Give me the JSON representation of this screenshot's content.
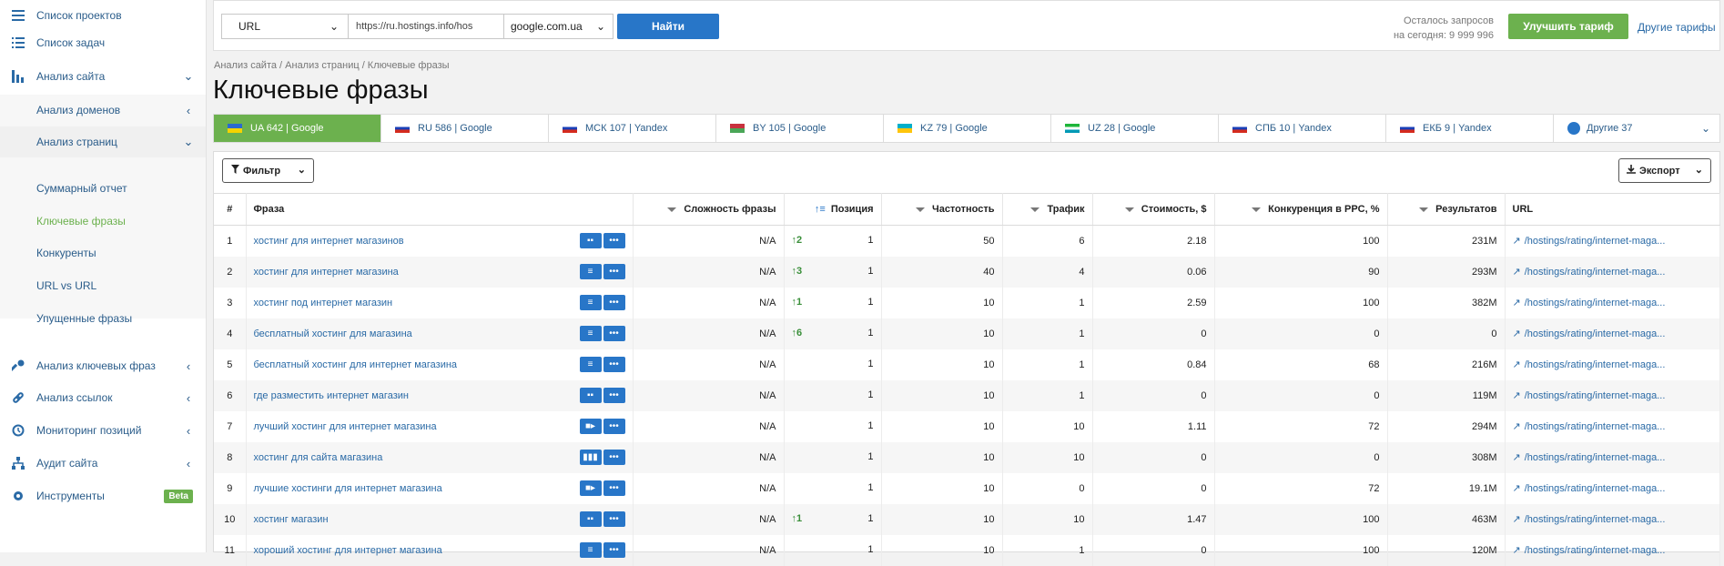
{
  "sidebar": {
    "items": [
      {
        "label": "Список проектов",
        "icon": "menu-icon"
      },
      {
        "label": "Список задач",
        "icon": "list-icon"
      },
      {
        "label": "Анализ сайта",
        "icon": "analytics-icon"
      },
      {
        "label": "Анализ доменов"
      },
      {
        "label": "Анализ страниц"
      },
      {
        "label": "Суммарный отчет"
      },
      {
        "label": "Ключевые фразы"
      },
      {
        "label": "Конкуренты"
      },
      {
        "label": "URL vs URL"
      },
      {
        "label": "Упущенные фразы"
      },
      {
        "label": "Анализ ключевых фраз",
        "icon": "key-icon"
      },
      {
        "label": "Анализ ссылок",
        "icon": "link-icon"
      },
      {
        "label": "Мониторинг позиций",
        "icon": "history-icon"
      },
      {
        "label": "Аудит сайта",
        "icon": "sitemap-icon"
      },
      {
        "label": "Инструменты",
        "icon": "gear-icon",
        "badge": "Beta"
      }
    ]
  },
  "search": {
    "type_value": "URL",
    "url_value": "https://ru.hostings.info/hos",
    "db_value": "google.com.ua",
    "find_label": "Найти"
  },
  "quota": {
    "line1": "Осталось запросов",
    "line2": "на сегодня: 9 999 996"
  },
  "upgrade_label": "Улучшить тариф",
  "other_tariffs_label": "Другие тарифы",
  "breadcrumb": "Анализ сайта / Анализ страниц / Ключевые фразы",
  "page_title": "Ключевые фразы",
  "tabs": [
    {
      "label": "UA 642 | Google",
      "flag": [
        "#2a6ad0",
        "#f5d300"
      ]
    },
    {
      "label": "RU 586 | Google",
      "flag": [
        "#ffffff",
        "#1a3fb8",
        "#d52b1e"
      ]
    },
    {
      "label": "МСК 107 | Yandex",
      "flag": [
        "#ffffff",
        "#1a3fb8",
        "#d52b1e"
      ]
    },
    {
      "label": "BY 105 | Google",
      "flag": [
        "#c8313e",
        "#4aa657"
      ]
    },
    {
      "label": "KZ 79 | Google",
      "flag": [
        "#00afca",
        "#fec50c"
      ]
    },
    {
      "label": "UZ 28 | Google",
      "flag": [
        "#1eb53a",
        "#ffffff",
        "#0099b5"
      ]
    },
    {
      "label": "СПБ 10 | Yandex",
      "flag": [
        "#ffffff",
        "#1a3fb8",
        "#d52b1e"
      ]
    },
    {
      "label": "ЕКБ 9 | Yandex",
      "flag": [
        "#ffffff",
        "#1a3fb8",
        "#d52b1e"
      ]
    },
    {
      "label": "Другие 37",
      "icon": "globe-icon"
    }
  ],
  "filter_label": "Фильтр",
  "export_label": "Экспорт",
  "table": {
    "headers": [
      "#",
      "Фраза",
      "Сложность фразы",
      "Позиция",
      "Частотность",
      "Трафик",
      "Стоимость, $",
      "Конкуренция в PPC, %",
      "Результатов",
      "URL"
    ],
    "rows": [
      {
        "n": "1",
        "phrase": "хостинг для интернет магазинов",
        "icon1": "chat-icon",
        "diff": "N/A",
        "change": "2",
        "pos": "1",
        "freq": "50",
        "traffic": "6",
        "cost": "2.18",
        "ppc": "100",
        "results": "231M",
        "url": "/hostings/rating/internet-maga..."
      },
      {
        "n": "2",
        "phrase": "хостинг для интернет магазина",
        "icon1": "text-icon",
        "diff": "N/A",
        "change": "3",
        "pos": "1",
        "freq": "40",
        "traffic": "4",
        "cost": "0.06",
        "ppc": "90",
        "results": "293M",
        "url": "/hostings/rating/internet-maga..."
      },
      {
        "n": "3",
        "phrase": "хостинг под интернет магазин",
        "icon1": "text-icon",
        "diff": "N/A",
        "change": "1",
        "pos": "1",
        "freq": "10",
        "traffic": "1",
        "cost": "2.59",
        "ppc": "100",
        "results": "382M",
        "url": "/hostings/rating/internet-maga..."
      },
      {
        "n": "4",
        "phrase": "бесплатный хостинг для магазина",
        "icon1": "text-icon",
        "diff": "N/A",
        "change": "6",
        "pos": "1",
        "freq": "10",
        "traffic": "1",
        "cost": "0",
        "ppc": "0",
        "results": "0",
        "url": "/hostings/rating/internet-maga..."
      },
      {
        "n": "5",
        "phrase": "бесплатный хостинг для интернет магазина",
        "icon1": "text-icon",
        "diff": "N/A",
        "change": "",
        "pos": "1",
        "freq": "10",
        "traffic": "1",
        "cost": "0.84",
        "ppc": "68",
        "results": "216M",
        "url": "/hostings/rating/internet-maga..."
      },
      {
        "n": "6",
        "phrase": "где разместить интернет магазин",
        "icon1": "chat-icon",
        "diff": "N/A",
        "change": "",
        "pos": "1",
        "freq": "10",
        "traffic": "1",
        "cost": "0",
        "ppc": "0",
        "results": "119M",
        "url": "/hostings/rating/internet-maga..."
      },
      {
        "n": "7",
        "phrase": "лучший хостинг для интернет магазина",
        "icon1": "video-icon",
        "diff": "N/A",
        "change": "",
        "pos": "1",
        "freq": "10",
        "traffic": "10",
        "cost": "1.11",
        "ppc": "72",
        "results": "294M",
        "url": "/hostings/rating/internet-maga..."
      },
      {
        "n": "8",
        "phrase": "хостинг для сайта магазина",
        "icon1": "columns-icon",
        "diff": "N/A",
        "change": "",
        "pos": "1",
        "freq": "10",
        "traffic": "10",
        "cost": "0",
        "ppc": "0",
        "results": "308M",
        "url": "/hostings/rating/internet-maga..."
      },
      {
        "n": "9",
        "phrase": "лучшие хостинги для интернет магазина",
        "icon1": "video-icon",
        "diff": "N/A",
        "change": "",
        "pos": "1",
        "freq": "10",
        "traffic": "0",
        "cost": "0",
        "ppc": "72",
        "results": "19.1M",
        "url": "/hostings/rating/internet-maga..."
      },
      {
        "n": "10",
        "phrase": "хостинг магазин",
        "icon1": "chat-icon",
        "diff": "N/A",
        "change": "1",
        "pos": "1",
        "freq": "10",
        "traffic": "10",
        "cost": "1.47",
        "ppc": "100",
        "results": "463M",
        "url": "/hostings/rating/internet-maga..."
      },
      {
        "n": "11",
        "phrase": "хороший хостинг для интернет магазина",
        "icon1": "text-icon",
        "diff": "N/A",
        "change": "",
        "pos": "1",
        "freq": "10",
        "traffic": "1",
        "cost": "0",
        "ppc": "100",
        "results": "120M",
        "url": "/hostings/rating/internet-maga..."
      }
    ]
  }
}
